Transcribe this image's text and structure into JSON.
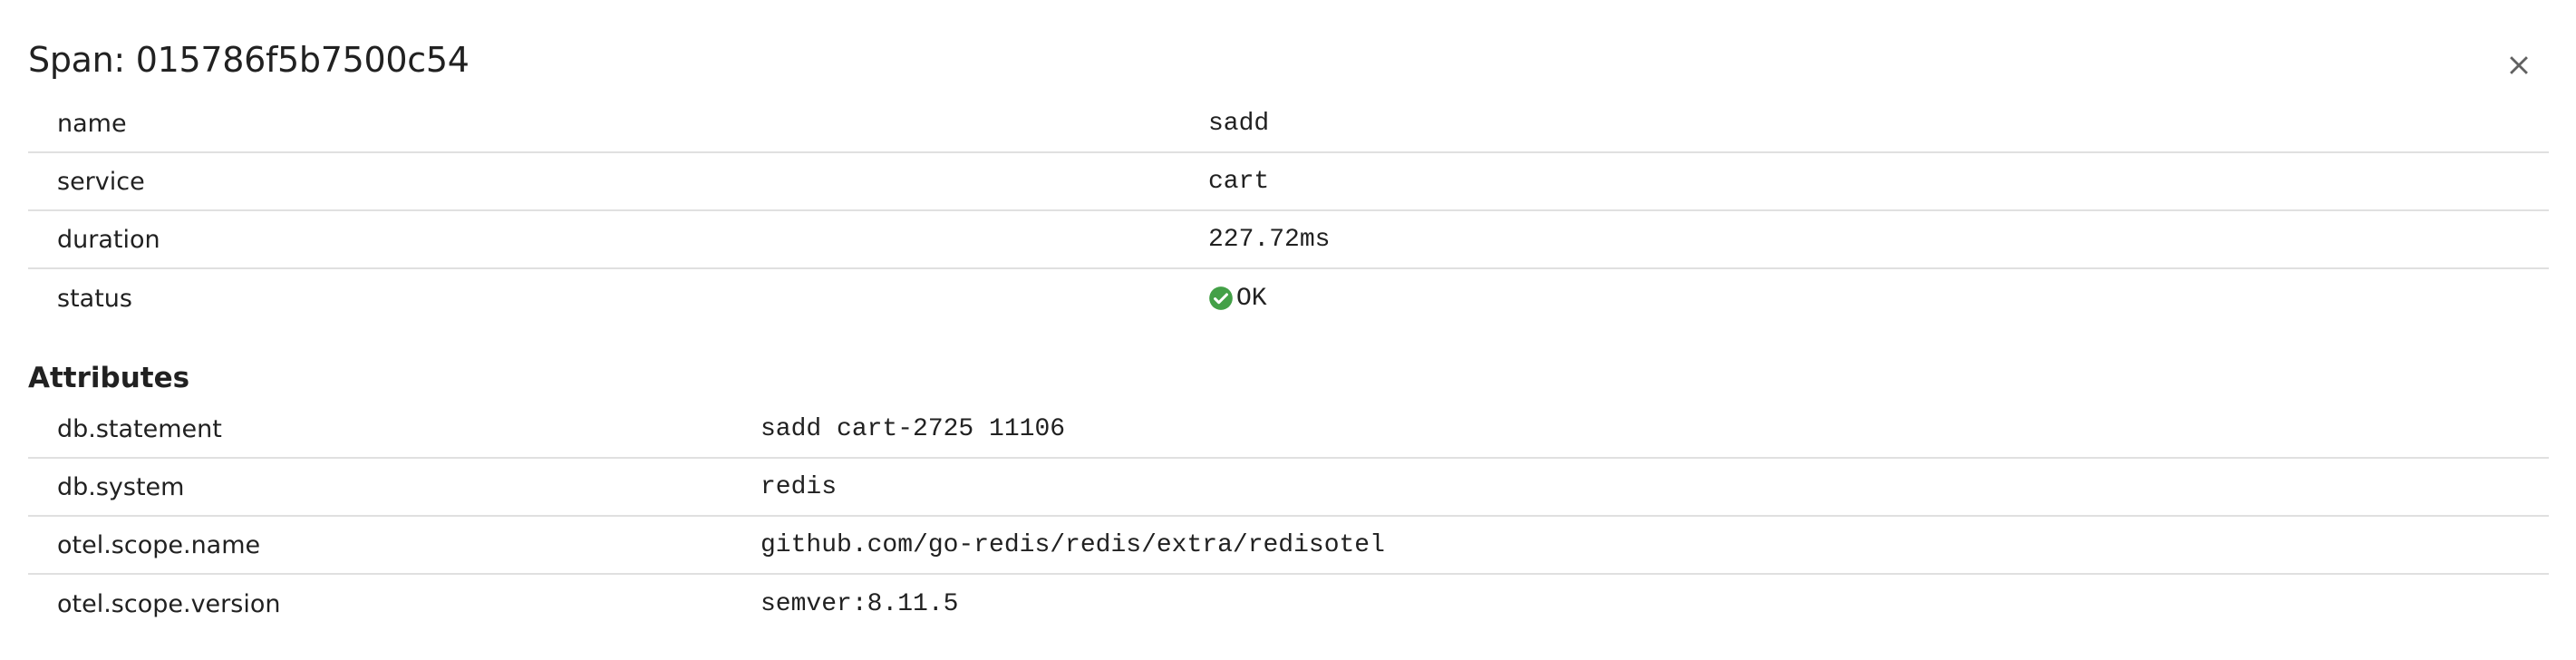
{
  "header": {
    "title": "Span: 015786f5b7500c54"
  },
  "span": {
    "rows": [
      {
        "key": "name",
        "value": "sadd"
      },
      {
        "key": "service",
        "value": "cart"
      },
      {
        "key": "duration",
        "value": "227.72ms"
      },
      {
        "key": "status",
        "value": "OK",
        "icon": "check-circle-icon",
        "status_color": "#43a047"
      }
    ]
  },
  "attributes": {
    "title": "Attributes",
    "rows": [
      {
        "key": "db.statement",
        "value": "sadd cart-2725 11106"
      },
      {
        "key": "db.system",
        "value": "redis"
      },
      {
        "key": "otel.scope.name",
        "value": "github.com/go-redis/redis/extra/redisotel"
      },
      {
        "key": "otel.scope.version",
        "value": "semver:8.11.5"
      }
    ]
  },
  "icons": {
    "close": "close-icon"
  }
}
